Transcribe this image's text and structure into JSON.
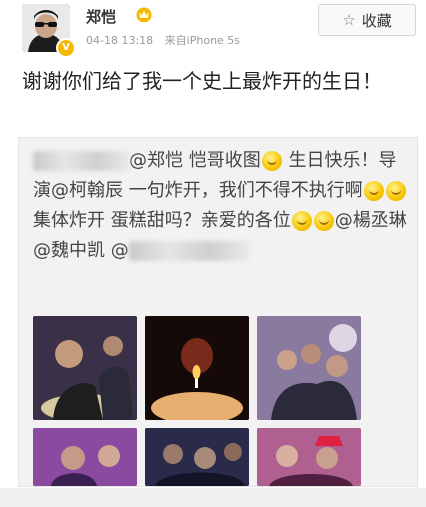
{
  "user": {
    "name": "郑恺",
    "badge": "V",
    "crown_icon": "crown-icon",
    "time": "04-18 13:18",
    "source": "来自iPhone 5s"
  },
  "actions": {
    "favorite_icon": "star-outline-icon",
    "favorite_label": "收藏"
  },
  "post": {
    "text": "谢谢你们给了我一个史上最炸开的生日！"
  },
  "repost": {
    "segments": [
      {
        "type": "blur",
        "w": 96
      },
      {
        "type": "text",
        "value": "@郑恺 恺哥收图"
      },
      {
        "type": "emoji"
      },
      {
        "type": "text",
        "value": " 生日快乐！导演@柯翰辰 一句炸开，我们不得不执行啊"
      },
      {
        "type": "emoji"
      },
      {
        "type": "emoji"
      },
      {
        "type": "text",
        "value": " 集体炸开 蛋糕甜吗？亲爱的各位"
      },
      {
        "type": "emoji"
      },
      {
        "type": "emoji"
      },
      {
        "type": "text",
        "value": "@楊丞琳 @魏中凯 @"
      },
      {
        "type": "blur",
        "w": 120
      }
    ]
  },
  "photos": [
    {
      "name": "photo-1",
      "bg": "#3a3048"
    },
    {
      "name": "photo-2",
      "bg": "#1a0c0a"
    },
    {
      "name": "photo-3",
      "bg": "#6a5a7a"
    },
    {
      "name": "photo-4",
      "bg": "#8a4aa0"
    },
    {
      "name": "photo-5",
      "bg": "#2a2a4a"
    },
    {
      "name": "photo-6",
      "bg": "#b06090"
    }
  ]
}
